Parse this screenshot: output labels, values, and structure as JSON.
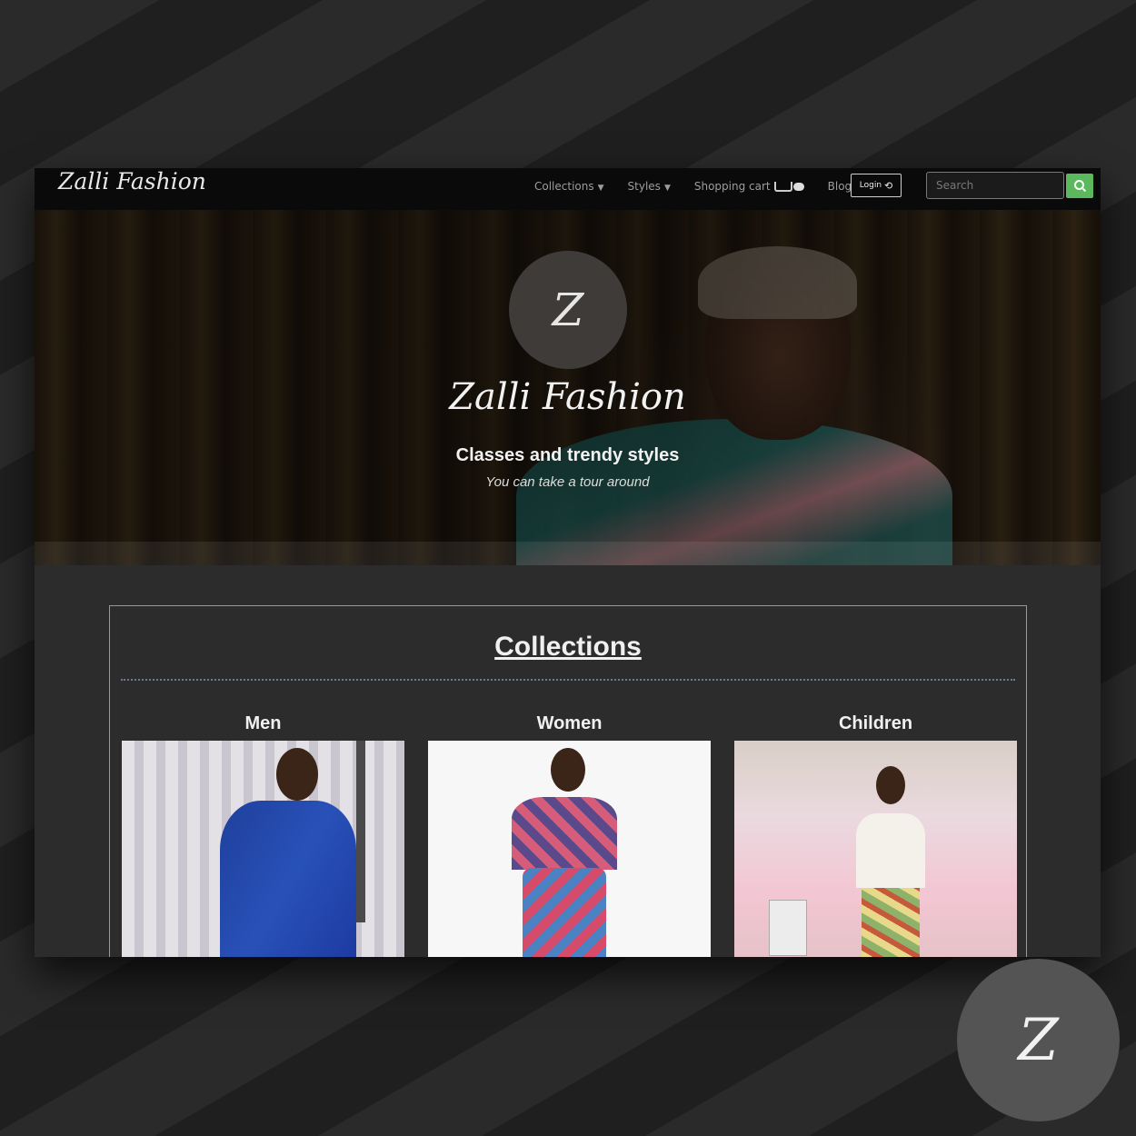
{
  "navbar": {
    "brand": "Zalli Fashion",
    "items": [
      {
        "label": "Collections",
        "dropdown": true
      },
      {
        "label": "Styles",
        "dropdown": true
      },
      {
        "label": "Shopping cart",
        "dropdown": false
      },
      {
        "label": "Blog",
        "dropdown": false
      }
    ],
    "login_label": "Login",
    "search_placeholder": "Search"
  },
  "hero": {
    "logo_letter": "Z",
    "title": "Zalli Fashion",
    "subtitle": "Classes and trendy styles",
    "tagline": "You can take a tour around"
  },
  "collections": {
    "title": "Collections",
    "items": [
      {
        "label": "Men"
      },
      {
        "label": "Women"
      },
      {
        "label": "Children"
      }
    ]
  },
  "badge": {
    "letter": "Z"
  },
  "colors": {
    "accent": "#5cb85c",
    "background": "#262626",
    "panel": "#2c2c2c",
    "navbar": "#0b0b0b"
  },
  "icons": [
    "caret-down-icon",
    "cart-icon",
    "login-icon",
    "search-icon"
  ]
}
